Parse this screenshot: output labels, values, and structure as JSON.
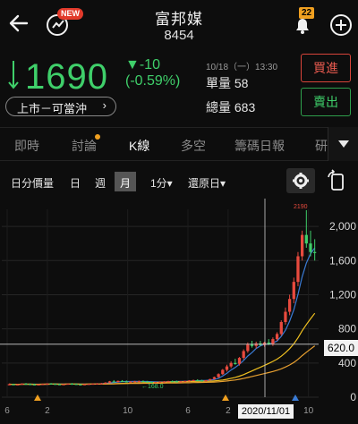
{
  "header": {
    "title": "富邦媒",
    "code": "8454",
    "new_badge": "NEW",
    "notification_count": "22"
  },
  "quote": {
    "price": "1690",
    "change": "▼-10",
    "change_percent": "(-0.59%)",
    "time": "10/18（一）13:30",
    "single_volume": "單量 58",
    "total_volume": "總量 683",
    "market_tag": "上市－可當沖",
    "buy_label": "買進",
    "sell_label": "賣出",
    "down_color": "#3fcf6a",
    "up_color": "#e85a4f"
  },
  "tabs": [
    "即時",
    "討論",
    "K線",
    "多空",
    "籌碼日報",
    "研"
  ],
  "active_tab": "K線",
  "toolbar": {
    "items": [
      "日分價量",
      "日",
      "週",
      "月",
      "1分▾",
      "還原日▾"
    ],
    "active": "月"
  },
  "chart_data": {
    "type": "candlestick",
    "period": "月",
    "y_ticks": [
      "2,000",
      "1,600",
      "1,200",
      "800",
      "400",
      "0"
    ],
    "ylim": [
      0,
      2200
    ],
    "annotations": {
      "high": "2190",
      "low": "168.0"
    },
    "crosshair": {
      "price": "620.0",
      "date": "2020/11/01"
    },
    "x_ticks": [
      "6",
      "2",
      "10",
      "6",
      "2",
      "10",
      "6",
      "2",
      "10",
      "6"
    ],
    "ma_series": [
      {
        "color": "#3a7bd5"
      },
      {
        "color": "#f0c020"
      },
      {
        "color": "#e8a030"
      }
    ],
    "candles": [
      {
        "o": 150,
        "h": 160,
        "l": 140,
        "c": 152
      },
      {
        "o": 152,
        "h": 158,
        "l": 145,
        "c": 148
      },
      {
        "o": 148,
        "h": 155,
        "l": 140,
        "c": 150
      },
      {
        "o": 150,
        "h": 162,
        "l": 148,
        "c": 158
      },
      {
        "o": 158,
        "h": 165,
        "l": 150,
        "c": 154
      },
      {
        "o": 154,
        "h": 160,
        "l": 145,
        "c": 150
      },
      {
        "o": 150,
        "h": 158,
        "l": 142,
        "c": 146
      },
      {
        "o": 146,
        "h": 152,
        "l": 140,
        "c": 150
      },
      {
        "o": 150,
        "h": 158,
        "l": 145,
        "c": 155
      },
      {
        "o": 155,
        "h": 162,
        "l": 150,
        "c": 160
      },
      {
        "o": 160,
        "h": 165,
        "l": 152,
        "c": 156
      },
      {
        "o": 156,
        "h": 160,
        "l": 148,
        "c": 152
      },
      {
        "o": 152,
        "h": 158,
        "l": 145,
        "c": 148
      },
      {
        "o": 148,
        "h": 155,
        "l": 142,
        "c": 152
      },
      {
        "o": 152,
        "h": 160,
        "l": 148,
        "c": 158
      },
      {
        "o": 158,
        "h": 165,
        "l": 152,
        "c": 155
      },
      {
        "o": 155,
        "h": 160,
        "l": 148,
        "c": 150
      },
      {
        "o": 150,
        "h": 156,
        "l": 144,
        "c": 148
      },
      {
        "o": 148,
        "h": 154,
        "l": 140,
        "c": 152
      },
      {
        "o": 152,
        "h": 158,
        "l": 146,
        "c": 156
      },
      {
        "o": 156,
        "h": 162,
        "l": 150,
        "c": 158
      },
      {
        "o": 158,
        "h": 165,
        "l": 152,
        "c": 160
      },
      {
        "o": 160,
        "h": 168,
        "l": 155,
        "c": 162
      },
      {
        "o": 162,
        "h": 175,
        "l": 158,
        "c": 170
      },
      {
        "o": 170,
        "h": 190,
        "l": 165,
        "c": 185
      },
      {
        "o": 185,
        "h": 200,
        "l": 178,
        "c": 180
      },
      {
        "o": 180,
        "h": 195,
        "l": 172,
        "c": 190
      },
      {
        "o": 190,
        "h": 200,
        "l": 182,
        "c": 185
      },
      {
        "o": 185,
        "h": 195,
        "l": 175,
        "c": 178
      },
      {
        "o": 178,
        "h": 188,
        "l": 170,
        "c": 182
      },
      {
        "o": 182,
        "h": 190,
        "l": 176,
        "c": 186
      },
      {
        "o": 186,
        "h": 195,
        "l": 180,
        "c": 188
      },
      {
        "o": 188,
        "h": 196,
        "l": 180,
        "c": 184
      },
      {
        "o": 184,
        "h": 190,
        "l": 175,
        "c": 178
      },
      {
        "o": 178,
        "h": 185,
        "l": 168,
        "c": 172
      },
      {
        "o": 172,
        "h": 180,
        "l": 168,
        "c": 176
      },
      {
        "o": 176,
        "h": 185,
        "l": 170,
        "c": 180
      },
      {
        "o": 180,
        "h": 188,
        "l": 175,
        "c": 184
      },
      {
        "o": 184,
        "h": 192,
        "l": 178,
        "c": 188
      },
      {
        "o": 188,
        "h": 196,
        "l": 182,
        "c": 186
      },
      {
        "o": 186,
        "h": 194,
        "l": 178,
        "c": 182
      },
      {
        "o": 182,
        "h": 190,
        "l": 176,
        "c": 184
      },
      {
        "o": 184,
        "h": 192,
        "l": 180,
        "c": 190
      },
      {
        "o": 190,
        "h": 200,
        "l": 185,
        "c": 196
      },
      {
        "o": 196,
        "h": 205,
        "l": 190,
        "c": 200
      },
      {
        "o": 200,
        "h": 210,
        "l": 192,
        "c": 196
      },
      {
        "o": 196,
        "h": 204,
        "l": 188,
        "c": 192
      },
      {
        "o": 192,
        "h": 200,
        "l": 185,
        "c": 198
      },
      {
        "o": 198,
        "h": 215,
        "l": 195,
        "c": 212
      },
      {
        "o": 212,
        "h": 240,
        "l": 205,
        "c": 235
      },
      {
        "o": 235,
        "h": 280,
        "l": 228,
        "c": 270
      },
      {
        "o": 270,
        "h": 330,
        "l": 260,
        "c": 320
      },
      {
        "o": 320,
        "h": 380,
        "l": 300,
        "c": 360
      },
      {
        "o": 360,
        "h": 420,
        "l": 340,
        "c": 400
      },
      {
        "o": 400,
        "h": 450,
        "l": 380,
        "c": 390
      },
      {
        "o": 390,
        "h": 470,
        "l": 370,
        "c": 460
      },
      {
        "o": 460,
        "h": 560,
        "l": 440,
        "c": 540
      },
      {
        "o": 540,
        "h": 640,
        "l": 520,
        "c": 620
      },
      {
        "o": 620,
        "h": 660,
        "l": 580,
        "c": 600
      },
      {
        "o": 600,
        "h": 650,
        "l": 570,
        "c": 630
      },
      {
        "o": 630,
        "h": 660,
        "l": 600,
        "c": 610
      },
      {
        "o": 610,
        "h": 650,
        "l": 590,
        "c": 640
      },
      {
        "o": 640,
        "h": 680,
        "l": 610,
        "c": 620
      },
      {
        "o": 620,
        "h": 700,
        "l": 600,
        "c": 680
      },
      {
        "o": 680,
        "h": 760,
        "l": 660,
        "c": 740
      },
      {
        "o": 740,
        "h": 900,
        "l": 720,
        "c": 880
      },
      {
        "o": 880,
        "h": 1050,
        "l": 850,
        "c": 1000
      },
      {
        "o": 1000,
        "h": 1200,
        "l": 960,
        "c": 1150
      },
      {
        "o": 1150,
        "h": 1400,
        "l": 1100,
        "c": 1350
      },
      {
        "o": 1350,
        "h": 1700,
        "l": 1300,
        "c": 1650
      },
      {
        "o": 1650,
        "h": 1950,
        "l": 1600,
        "c": 1900
      },
      {
        "o": 1900,
        "h": 2190,
        "l": 1750,
        "c": 1800
      },
      {
        "o": 1800,
        "h": 1950,
        "l": 1650,
        "c": 1700
      },
      {
        "o": 1700,
        "h": 1850,
        "l": 1600,
        "c": 1690
      }
    ]
  }
}
